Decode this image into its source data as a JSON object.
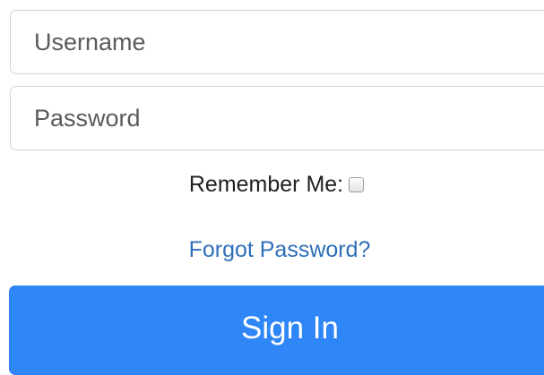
{
  "login": {
    "username_placeholder": "Username",
    "password_placeholder": "Password",
    "remember_label": "Remember Me:",
    "remember_checked": false,
    "forgot_label": "Forgot Password?",
    "signin_label": "Sign In"
  },
  "colors": {
    "primary_button": "#2f86f6",
    "link": "#2f6fb8",
    "input_border": "#d3d3d3"
  }
}
